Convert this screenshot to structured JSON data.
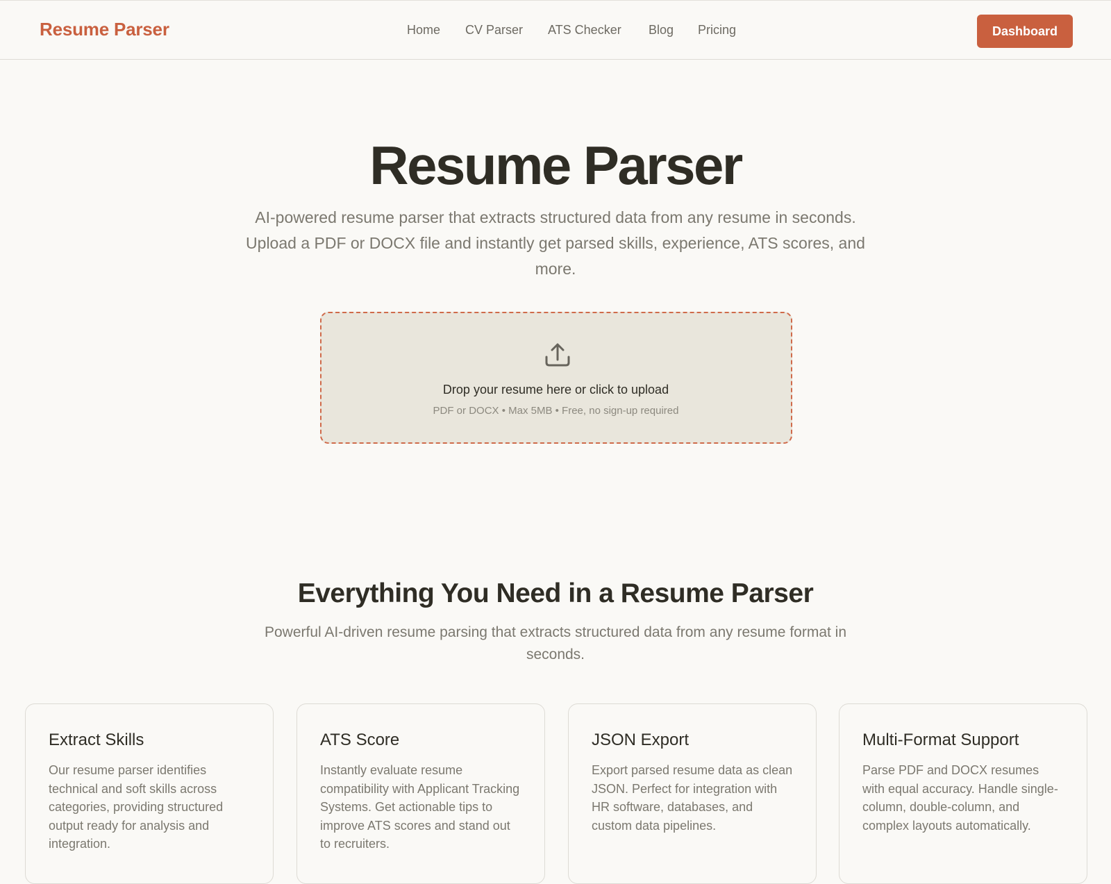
{
  "header": {
    "logo": "Resume Parser",
    "nav": [
      "Home",
      "CV Parser",
      "ATS Checker",
      "Blog",
      "Pricing"
    ],
    "dashboard_label": "Dashboard"
  },
  "hero": {
    "title": "Resume Parser",
    "subtitle": "AI-powered resume parser that extracts structured data from any resume in seconds. Upload a PDF or DOCX file and instantly get parsed skills, experience, ATS scores, and more."
  },
  "upload": {
    "icon": "upload-icon",
    "title": "Drop your resume here or click to upload",
    "hint": "PDF or DOCX • Max 5MB • Free, no sign-up required"
  },
  "features": {
    "title": "Everything You Need in a Resume Parser",
    "subtitle": "Powerful AI-driven resume parsing that extracts structured data from any resume format in seconds.",
    "cards": [
      {
        "title": "Extract Skills",
        "desc": "Our resume parser identifies technical and soft skills across categories, providing structured output ready for analysis and integration."
      },
      {
        "title": "ATS Score",
        "desc": "Instantly evaluate resume compatibility with Applicant Tracking Systems. Get actionable tips to improve ATS scores and stand out to recruiters."
      },
      {
        "title": "JSON Export",
        "desc": "Export parsed resume data as clean JSON. Perfect for integration with HR software, databases, and custom data pipelines."
      },
      {
        "title": "Multi-Format Support",
        "desc": "Parse PDF and DOCX resumes with equal accuracy. Handle single-column, double-column, and complex layouts automatically."
      }
    ]
  },
  "colors": {
    "accent": "#c9603f",
    "background": "#faf9f6",
    "dropzone_bg": "#e9e6dc",
    "text": "#2f2d25",
    "muted_text": "#7b786f"
  }
}
